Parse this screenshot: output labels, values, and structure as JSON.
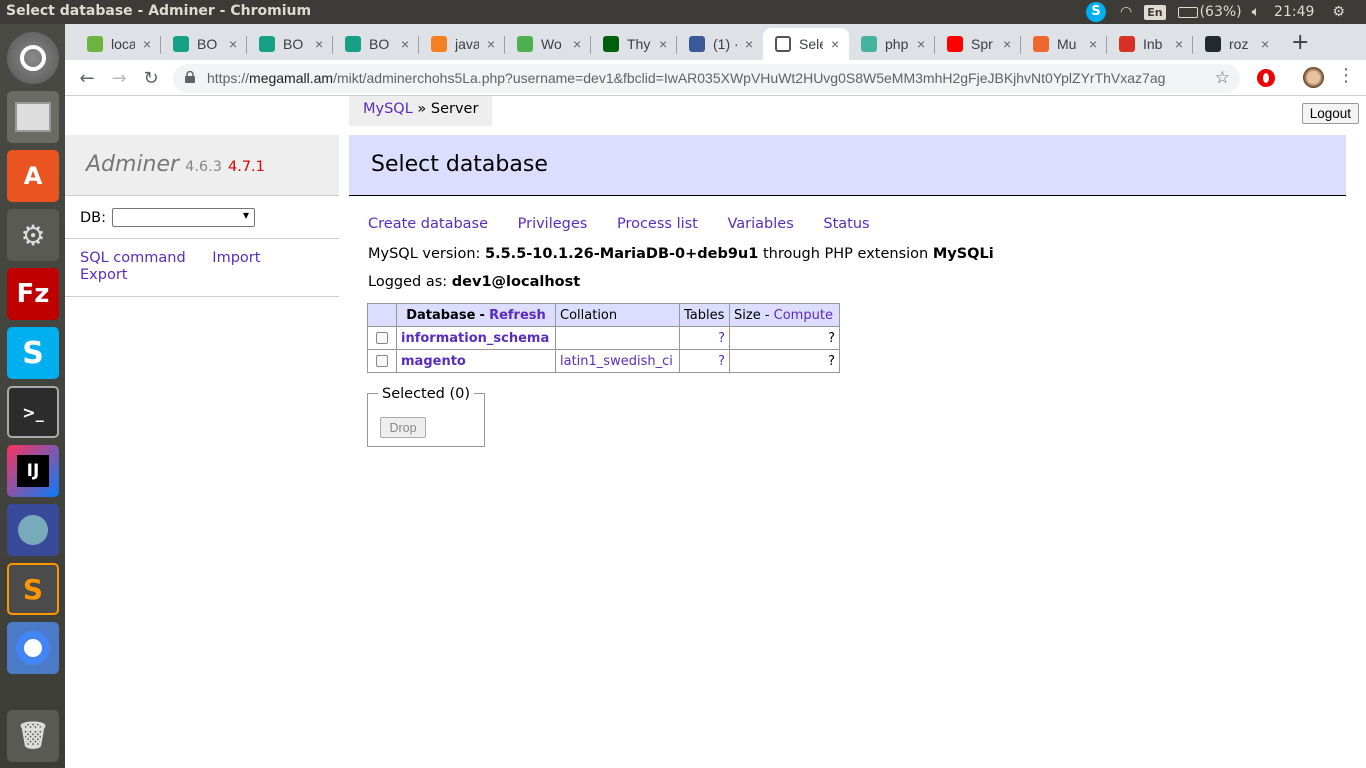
{
  "os": {
    "window_title": "Select database - Adminer - Chromium",
    "keyboard_layout": "En",
    "battery": "(63%)",
    "clock": "21:49"
  },
  "tabs": [
    {
      "label": "loca",
      "favicon_color": "#6db33f",
      "icon": "spring-leaf-icon"
    },
    {
      "label": "BO",
      "favicon_color": "#16a085",
      "icon": "search-circle-icon"
    },
    {
      "label": "BO",
      "favicon_color": "#16a085",
      "icon": "search-circle-icon"
    },
    {
      "label": "BO",
      "favicon_color": "#16a085",
      "icon": "search-circle-icon"
    },
    {
      "label": "java",
      "favicon_color": "#f48024",
      "icon": "stackoverflow-icon"
    },
    {
      "label": "Wo",
      "favicon_color": "#4caf50",
      "icon": "leaf-icon"
    },
    {
      "label": "Thy",
      "favicon_color": "#005f0f",
      "icon": "check-icon"
    },
    {
      "label": "(1) ·",
      "favicon_color": "#3b5998",
      "icon": "facebook-icon"
    },
    {
      "label": "Sele",
      "favicon_color": "#ffffff",
      "icon": "adminer-icon",
      "active": true
    },
    {
      "label": "php",
      "favicon_color": "#45b39d",
      "icon": "m-icon"
    },
    {
      "label": "Spr",
      "favicon_color": "#ff0000",
      "icon": "youtube-icon"
    },
    {
      "label": "Mu",
      "favicon_color": "#ee672f",
      "icon": "magento-icon"
    },
    {
      "label": "Inb",
      "favicon_color": "#d93025",
      "icon": "gmail-icon"
    },
    {
      "label": "roz",
      "favicon_color": "#24292e",
      "icon": "github-icon"
    }
  ],
  "omnibox": {
    "scheme": "https://",
    "host": "megamall.am",
    "path": "/mikt/adminerchohs5La.php?username=dev1&fbclid=IwAR035XWpVHuWt2HUvg0S8W5eMM3mhH2gFjeJBKjhvNt0YplZYrThVxaz7ag"
  },
  "adminer": {
    "breadcrumb_link": "MySQL",
    "breadcrumb_sep": "»",
    "breadcrumb_current": "Server",
    "logout": "Logout",
    "brand": "Adminer",
    "version": "4.6.3",
    "new_version": "4.7.1",
    "db_label": "DB:",
    "side_links": [
      "SQL command",
      "Import",
      "Export"
    ],
    "heading": "Select database",
    "links": [
      "Create database",
      "Privileges",
      "Process list",
      "Variables",
      "Status"
    ],
    "mysql_version_label": "MySQL version:",
    "mysql_version": "5.5.5-10.1.26-MariaDB-0+deb9u1",
    "through_text": "through PHP extension",
    "extension": "MySQLi",
    "logged_label": "Logged as:",
    "logged_user": "dev1@localhost",
    "table": {
      "header_database": "Database",
      "header_dash": "-",
      "header_refresh": "Refresh",
      "header_collation": "Collation",
      "header_tables": "Tables",
      "header_size": "Size",
      "header_compute": "Compute",
      "rows": [
        {
          "name": "information_schema",
          "collation": "",
          "tables": "?",
          "size": "?"
        },
        {
          "name": "magento",
          "collation": "latin1_swedish_ci",
          "tables": "?",
          "size": "?"
        }
      ]
    },
    "selected_legend": "Selected (0)",
    "drop": "Drop"
  }
}
